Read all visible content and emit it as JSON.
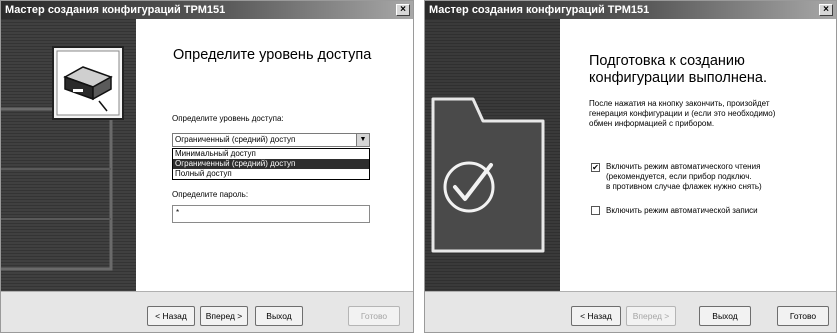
{
  "left_window": {
    "title": "Мастер создания конфигураций ТРМ151",
    "close_glyph": "×",
    "heading": "Определите уровень доступа",
    "access_label": "Определите уровень доступа:",
    "access_selected": "Ограниченный (средний) доступ",
    "combo_arrow": "▼",
    "access_options": [
      "Минимальный доступ",
      "Ограниченный (средний) доступ",
      "Полный доступ"
    ],
    "password_label": "Определите пароль:",
    "password_value": "*",
    "buttons": {
      "back": "< Назад",
      "next": "Вперед >",
      "exit": "Выход",
      "finish": "Готово"
    }
  },
  "right_window": {
    "title": "Мастер создания конфигураций ТРМ151",
    "close_glyph": "×",
    "heading_line1": "Подготовка к созданию",
    "heading_line2": "конфигурации выполнена.",
    "info_line1": "После нажатия на кнопку закончить, произойдет",
    "info_line2": "генерация конфигурации и (если это необходимо)",
    "info_line3": "обмен информацией с прибором.",
    "auto_read_line1": "Включить режим автоматического чтения",
    "auto_read_line2": "(рекомендуется, если прибор подключ.",
    "auto_read_line3": "в противном случае флажек нужно снять)",
    "auto_read_checked": "✔",
    "auto_write": "Включить режим автоматической записи",
    "buttons": {
      "back": "< Назад",
      "next": "Вперед >",
      "exit": "Выход",
      "finish": "Готово"
    }
  },
  "colors": {
    "title_dark": "#2a2a2a",
    "selection": "#2e2e2e"
  }
}
